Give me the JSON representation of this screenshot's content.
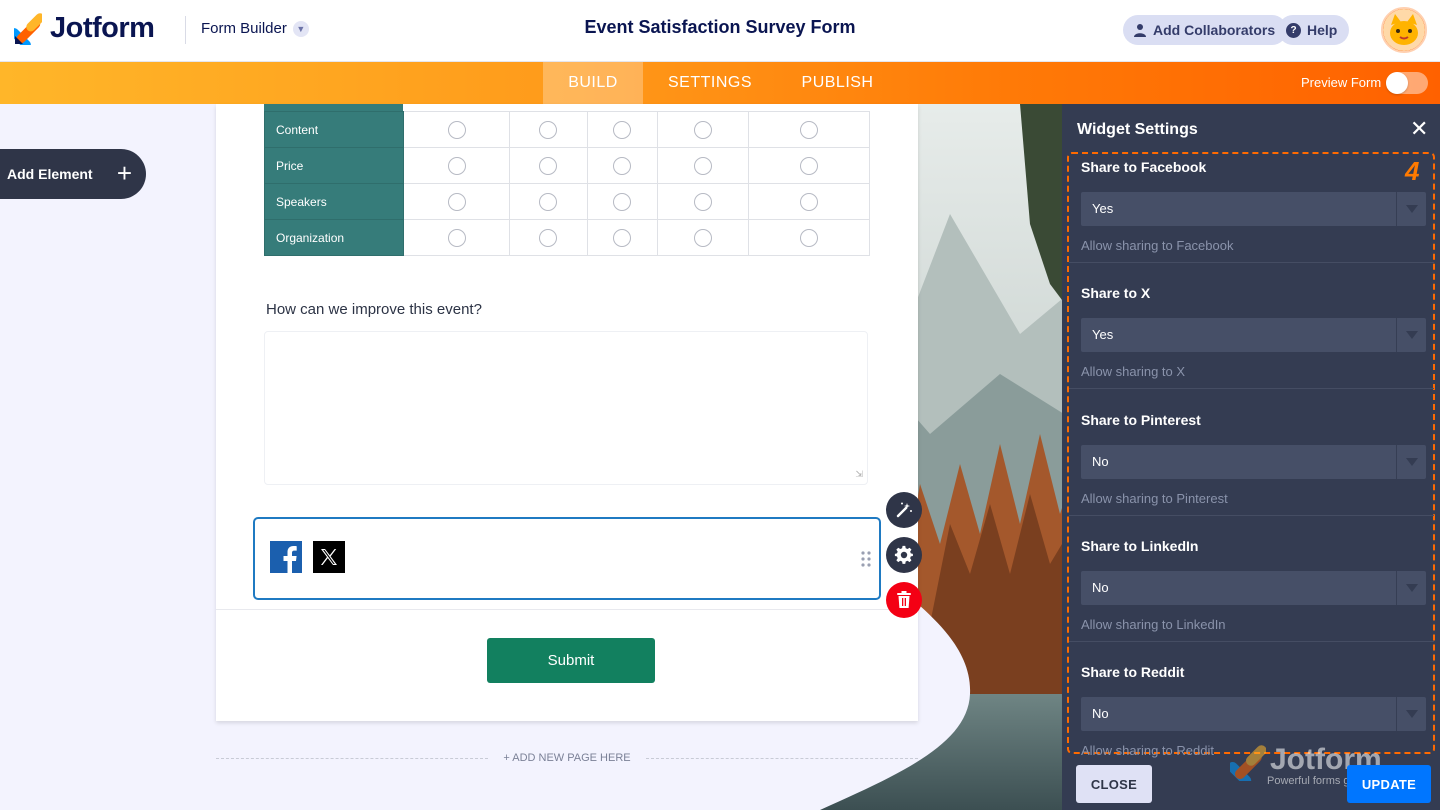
{
  "app": {
    "logo_text": "Jotform",
    "mode_selector": "Form Builder",
    "form_title": "Event Satisfaction Survey Form",
    "add_collaborators": "Add Collaborators",
    "help": "Help"
  },
  "nav": {
    "tabs": [
      {
        "label": "BUILD",
        "active": true
      },
      {
        "label": "SETTINGS",
        "active": false
      },
      {
        "label": "PUBLISH",
        "active": false
      }
    ],
    "preview_form": "Preview Form",
    "preview_on": false
  },
  "builder": {
    "add_element": "Add Element",
    "matrix_rows": [
      "Content",
      "Price",
      "Speakers",
      "Organization"
    ],
    "matrix_columns": 5,
    "question_label": "How can we improve this event?",
    "submit_label": "Submit",
    "add_new_page": "+ ADD NEW PAGE HERE"
  },
  "panel": {
    "title": "Widget Settings",
    "step_number": "4",
    "settings": [
      {
        "label": "Share to Facebook",
        "value": "Yes",
        "hint": "Allow sharing to Facebook"
      },
      {
        "label": "Share to X",
        "value": "Yes",
        "hint": "Allow sharing to X"
      },
      {
        "label": "Share to Pinterest",
        "value": "No",
        "hint": "Allow sharing to Pinterest"
      },
      {
        "label": "Share to LinkedIn",
        "value": "No",
        "hint": "Allow sharing to LinkedIn"
      },
      {
        "label": "Share to Reddit",
        "value": "No",
        "hint": "Allow sharing to Reddit"
      }
    ],
    "close_label": "CLOSE",
    "update_label": "UPDATE",
    "watermark_name": "Jotform",
    "watermark_tagline": "Powerful forms get it done."
  },
  "colors": {
    "brand_navy": "#0a1551",
    "nav_orange": "#ff6100",
    "matrix_teal": "#367c7a",
    "submit_green": "#12805f",
    "update_blue": "#0076ff",
    "delete_red": "#f40014",
    "highlight": "#ff6a00"
  }
}
